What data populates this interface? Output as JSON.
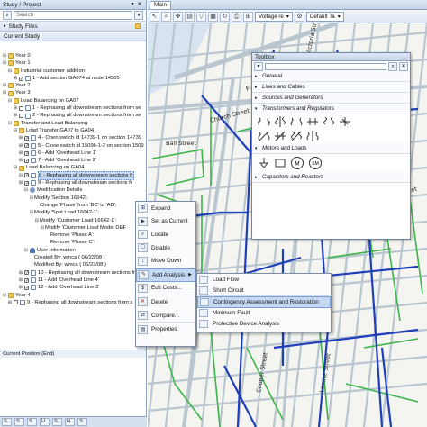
{
  "left_panel": {
    "title": "Study / Project",
    "search_placeholder": "Search",
    "study_files_label": "Study Files",
    "current_study_label": "Current Study",
    "current_position_label": "Current Position (End)",
    "tree": [
      {
        "indent": 0,
        "exp": "−",
        "icon": "folder",
        "check": false,
        "label": "Year 0"
      },
      {
        "indent": 0,
        "exp": "−",
        "icon": "folder",
        "check": false,
        "label": "Year 1"
      },
      {
        "indent": 1,
        "exp": "−",
        "icon": "folder",
        "check": false,
        "label": "Industrial customer addition"
      },
      {
        "indent": 2,
        "exp": "+",
        "icon": "chk-on",
        "check": true,
        "label": "1 - Add section GA074 at node 14505"
      },
      {
        "indent": 0,
        "exp": "−",
        "icon": "folder",
        "check": false,
        "label": "Year 2"
      },
      {
        "indent": 0,
        "exp": "−",
        "icon": "folder",
        "check": false,
        "label": "Year 3"
      },
      {
        "indent": 1,
        "exp": "−",
        "icon": "folder",
        "check": false,
        "label": "Load Balancing on GA07"
      },
      {
        "indent": 2,
        "exp": "+",
        "icon": "chk",
        "check": false,
        "label": "1 - Rephasing all downstream sections from se"
      },
      {
        "indent": 2,
        "exp": "+",
        "icon": "chk",
        "check": false,
        "label": "2 - Rephasing all downstream sections from se"
      },
      {
        "indent": 1,
        "exp": "−",
        "icon": "folder",
        "check": false,
        "label": "Transfer and Load Balancing"
      },
      {
        "indent": 2,
        "exp": "−",
        "icon": "folder",
        "check": false,
        "label": "Load Transfer GA07 to GA04"
      },
      {
        "indent": 3,
        "exp": "+",
        "icon": "chk-on",
        "check": true,
        "label": "4 - Open switch id 14739-1 on section 14739"
      },
      {
        "indent": 3,
        "exp": "+",
        "icon": "chk-on",
        "check": true,
        "label": "5 - Close switch id 15096-1-2 on section 1509"
      },
      {
        "indent": 3,
        "exp": "+",
        "icon": "chk-on",
        "check": true,
        "label": "6 - Add 'Overhead Line 1'"
      },
      {
        "indent": 3,
        "exp": "+",
        "icon": "chk-on",
        "check": true,
        "label": "7 - Add 'Overhead Line 2'"
      },
      {
        "indent": 2,
        "exp": "−",
        "icon": "folder",
        "check": false,
        "label": "Load Balancing on GA04"
      },
      {
        "indent": 3,
        "exp": "−",
        "icon": "chk-on",
        "check": true,
        "label": "8 - Rephasing all downstream sections fr",
        "selected": true
      },
      {
        "indent": 3,
        "exp": "+",
        "icon": "chk-on",
        "check": true,
        "label": "9 - Rephasing all downstream sections fr"
      },
      {
        "indent": 4,
        "exp": "−",
        "icon": "gear",
        "check": false,
        "label": "Modification Details"
      },
      {
        "indent": 5,
        "exp": "−",
        "icon": "",
        "check": false,
        "label": "Modify 'Section 16642':"
      },
      {
        "indent": 6,
        "exp": "",
        "icon": "",
        "check": false,
        "label": "Change 'Phase' from 'BC' to 'AB':"
      },
      {
        "indent": 5,
        "exp": "−",
        "icon": "",
        "check": false,
        "label": "Modify 'Spot Load 16642-1':"
      },
      {
        "indent": 6,
        "exp": "−",
        "icon": "",
        "check": false,
        "label": "Modify 'Customer Load 16642-1':"
      },
      {
        "indent": 7,
        "exp": "−",
        "icon": "",
        "check": false,
        "label": "Modify 'Customer Load Model DEF"
      },
      {
        "indent": 8,
        "exp": "",
        "icon": "",
        "check": false,
        "label": "Remove 'Phase A':"
      },
      {
        "indent": 8,
        "exp": "",
        "icon": "",
        "check": false,
        "label": "Remove 'Phase C':"
      },
      {
        "indent": 4,
        "exp": "−",
        "icon": "person",
        "check": false,
        "label": "User Information"
      },
      {
        "indent": 5,
        "exp": "",
        "icon": "",
        "check": false,
        "label": "Created By: wmca ( 06/23/08 )"
      },
      {
        "indent": 5,
        "exp": "",
        "icon": "",
        "check": false,
        "label": "Modified By: wmca ( 06/23/08 )"
      },
      {
        "indent": 3,
        "exp": "+",
        "icon": "chk-on",
        "check": true,
        "label": "10 - Rephasing all downstream sections fr"
      },
      {
        "indent": 3,
        "exp": "+",
        "icon": "chk-on",
        "check": true,
        "label": "11 - Add 'Overhead Line 4'"
      },
      {
        "indent": 3,
        "exp": "+",
        "icon": "chk-on",
        "check": true,
        "label": "12 - Add 'Overhead Line 3'"
      },
      {
        "indent": 0,
        "exp": "−",
        "icon": "folder",
        "check": false,
        "label": "Year 4"
      },
      {
        "indent": 1,
        "exp": "+",
        "icon": "chk",
        "check": false,
        "label": "9 - Rephasing all downstream sections from s"
      }
    ],
    "bottom_tabs": [
      "S..",
      "S..",
      "S..",
      "U..",
      "S..",
      "N..",
      "S.."
    ]
  },
  "main": {
    "tab_label": "Main",
    "voltage_combo": "Voltage re",
    "default_combo": "Default Ta"
  },
  "toolbox": {
    "title": "Toolbox",
    "categories": [
      "General",
      "Lines and Cables",
      "Sources and Generators",
      "Transformers and Regulators",
      "Motors and Loads",
      "Capacitors and Reactors"
    ],
    "motor_symbols": [
      "M",
      "SM"
    ]
  },
  "context_menu": {
    "items": [
      "Expand",
      "Set as Current",
      "Locate",
      "Disable",
      "Move Down",
      "Add Analysis",
      "Edit Costs...",
      "Delete",
      "Compare...",
      "Properties"
    ],
    "highlighted": "Add Analysis"
  },
  "submenu": {
    "items": [
      "Load Flow",
      "Short Circuit",
      "Contingency Assessment and Restoration",
      "Minimum Fault",
      "Protective Device Analysis"
    ],
    "highlighted": "Contingency Assessment and Restoration"
  },
  "map": {
    "street_labels": [
      "Fort Industrial Hwy",
      "Church Street",
      "Ball Street",
      "Grand Street",
      "Leveille",
      "Harrison Street",
      "Holland Street",
      "Beaulieu Street",
      "Cooper Street",
      "Wellington Street",
      "Victoria Street",
      "Lemire Street"
    ],
    "colors": {
      "feeder": "#1f3fb8",
      "secondary": "#3cb54a",
      "street": "#b9c5cf",
      "water": "#d7e3ee"
    }
  }
}
